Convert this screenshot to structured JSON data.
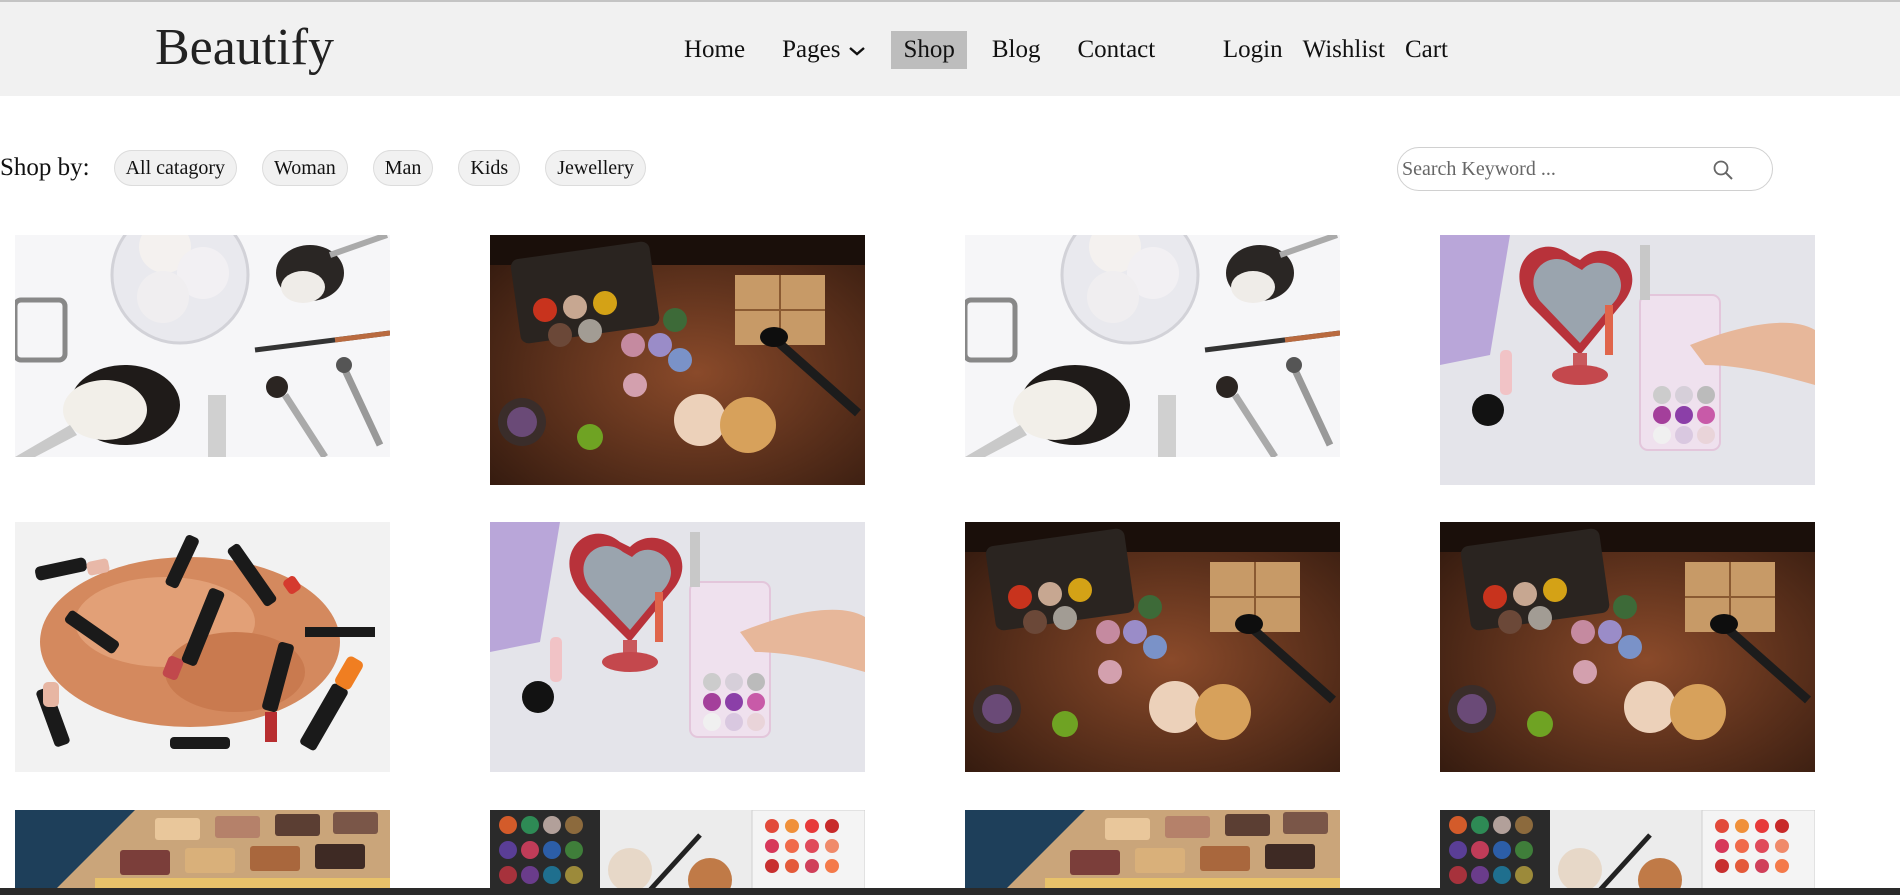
{
  "header": {
    "brand": "Beautify",
    "nav": [
      {
        "label": "Home"
      },
      {
        "label": "Pages"
      },
      {
        "label": "Shop"
      },
      {
        "label": "Blog"
      },
      {
        "label": "Contact"
      }
    ],
    "active_nav": "Shop",
    "account": [
      {
        "label": "Login"
      },
      {
        "label": "Wishlist"
      },
      {
        "label": "Cart"
      }
    ]
  },
  "filters": {
    "label": "Shop by:",
    "chips": [
      "All catagory",
      "Woman",
      "Man",
      "Kids",
      "Jewellery"
    ]
  },
  "search": {
    "placeholder": "Search Keyword ...",
    "value": ""
  },
  "products": [
    {
      "image": "brushes-white-flatlay"
    },
    {
      "image": "palette-wood-table"
    },
    {
      "image": "brushes-white-flatlay"
    },
    {
      "image": "heart-mirror-glitter"
    },
    {
      "image": "lipsticks-powder"
    },
    {
      "image": "heart-mirror-glitter"
    },
    {
      "image": "palette-wood-table"
    },
    {
      "image": "palette-wood-table"
    },
    {
      "image": "eyeshadow-closeup"
    },
    {
      "image": "palettes-pearls"
    },
    {
      "image": "eyeshadow-closeup"
    },
    {
      "image": "palettes-pearls"
    }
  ],
  "colors": {
    "header_bg": "#f1f1f1",
    "active_nav_bg": "#bdbdbd",
    "chip_bg": "#f1f1f1"
  }
}
